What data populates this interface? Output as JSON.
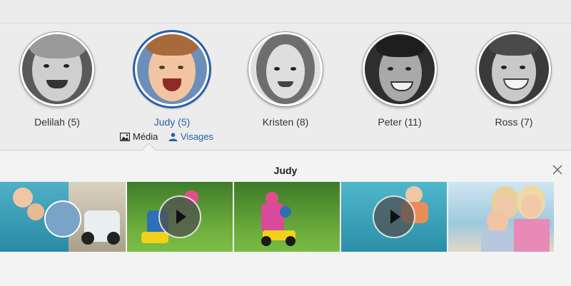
{
  "people": [
    {
      "label": "Delilah (5)",
      "selected": false
    },
    {
      "label": "Judy (5)",
      "selected": true
    },
    {
      "label": "Kristen (8)",
      "selected": false
    },
    {
      "label": "Peter (11)",
      "selected": false
    },
    {
      "label": "Ross (7)",
      "selected": false
    }
  ],
  "subtabs": {
    "media": {
      "label": "Média",
      "icon": "image-icon",
      "active": true
    },
    "faces": {
      "label": "Visages",
      "icon": "person-icon",
      "active": false
    }
  },
  "panel": {
    "title": "Judy",
    "close_icon": "close-icon"
  },
  "thumbnails": [
    {
      "type": "photo"
    },
    {
      "type": "video"
    },
    {
      "type": "photo"
    },
    {
      "type": "video"
    },
    {
      "type": "photo"
    }
  ],
  "colors": {
    "accent": "#2a5ea8",
    "background": "#ececec",
    "panel": "#f3f3f3"
  }
}
